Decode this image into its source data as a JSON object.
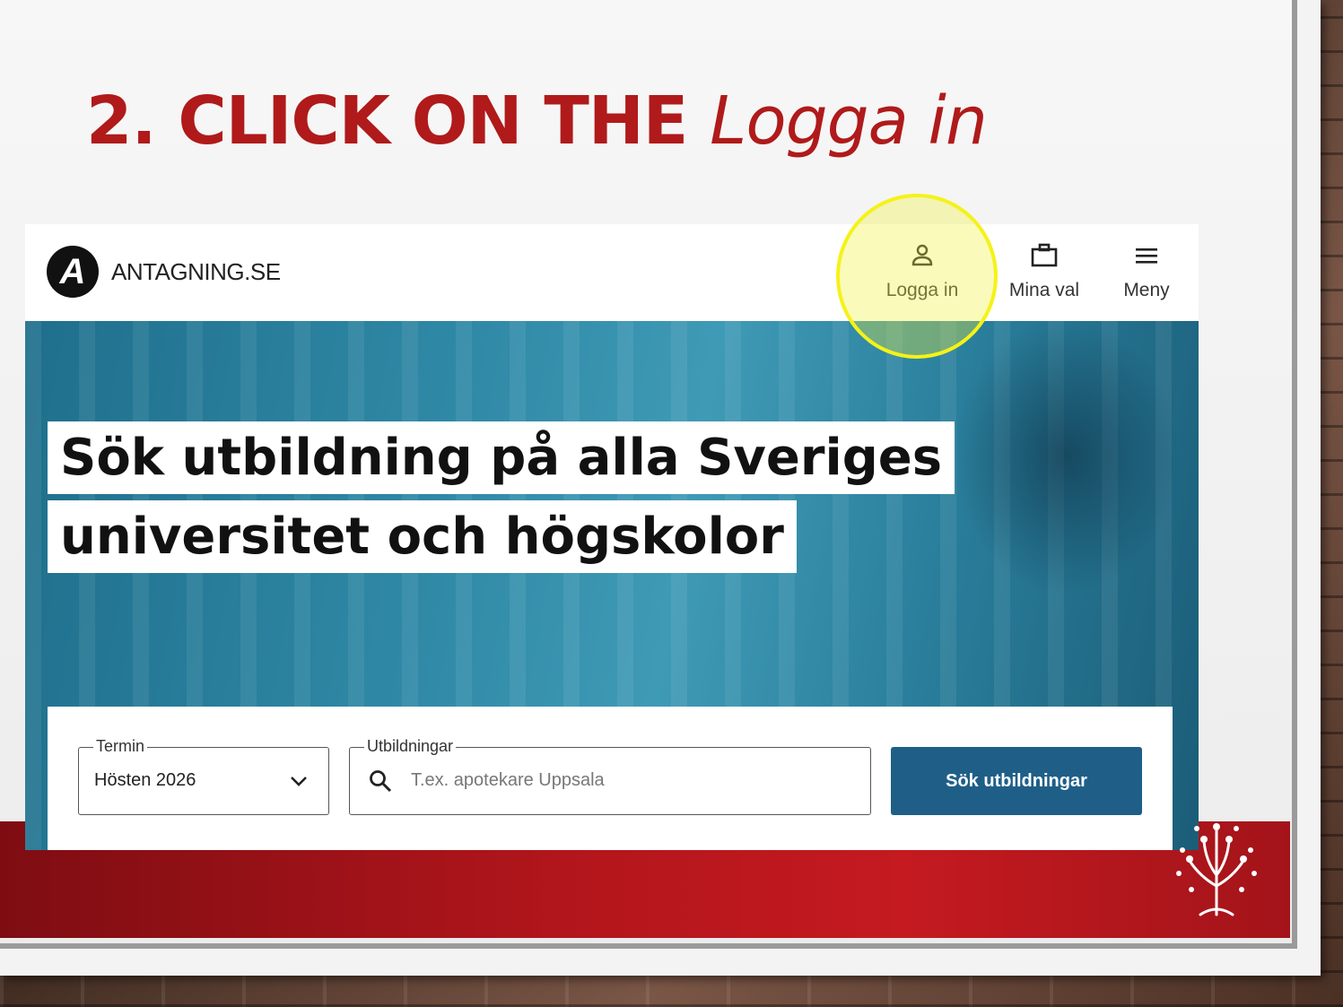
{
  "slide": {
    "title_prefix": "2. CLICK ON THE ",
    "title_emphasis": "Logga in",
    "title_color": "#b01a1a",
    "band_color": "#b3161c"
  },
  "site": {
    "logo_letter": "A",
    "brand": "ANTAGNING.SE",
    "nav": {
      "login": "Logga in",
      "choices": "Mina val",
      "menu": "Meny"
    },
    "headline_line1": "Sök utbildning på alla Sveriges",
    "headline_line2": "universitet och högskolor",
    "search": {
      "term_label": "Termin",
      "term_value": "Hösten 2026",
      "programs_label": "Utbildningar",
      "programs_placeholder": "T.ex. apotekare Uppsala",
      "submit": "Sök utbildningar"
    },
    "accent_color": "#1f5f87"
  },
  "icons": [
    "user-icon",
    "briefcase-icon",
    "hamburger-menu-icon",
    "chevron-down-icon",
    "search-icon",
    "tree-logo-icon"
  ],
  "highlight_color": "#f5f218"
}
